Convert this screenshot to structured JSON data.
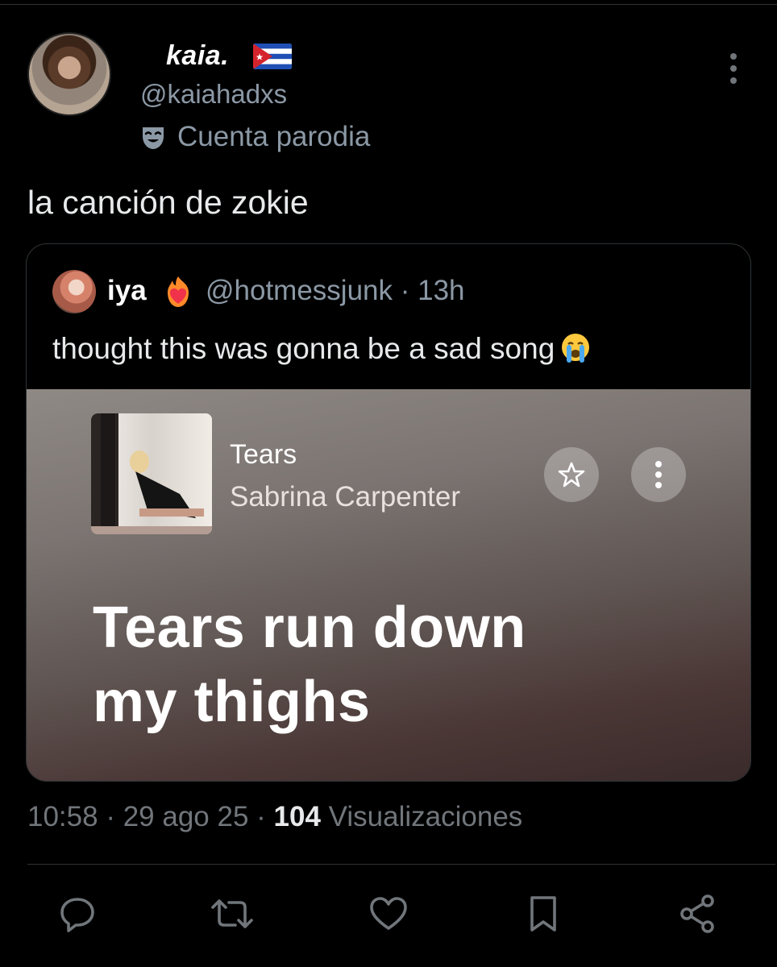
{
  "author": {
    "name": "kaia.",
    "handle": "@kaiahadxs",
    "label": "Cuenta parodia",
    "flag_icon": "cuba-flag-icon",
    "label_icon": "parody-mask-icon"
  },
  "tweet": {
    "text": "la canción de zokie"
  },
  "quote": {
    "name": "iya",
    "handle_time": "@hotmessjunk · 13h",
    "text": "thought this was gonna be a sad song",
    "text_emoji": "loudly-crying-face-icon",
    "name_emoji": "heart-on-fire-icon"
  },
  "media": {
    "song_title": "Tears",
    "artist": "Sabrina Carpenter",
    "lyric_line1": "Tears run down",
    "lyric_line2": "my thighs"
  },
  "meta": {
    "time": "10:58",
    "date": "29 ago 25",
    "views_count": "104",
    "views_label": "Visualizaciones"
  },
  "colors": {
    "background": "#000000",
    "muted_text": "#71767b",
    "primary_text": "#e7e9ea",
    "border": "#2f3336"
  }
}
